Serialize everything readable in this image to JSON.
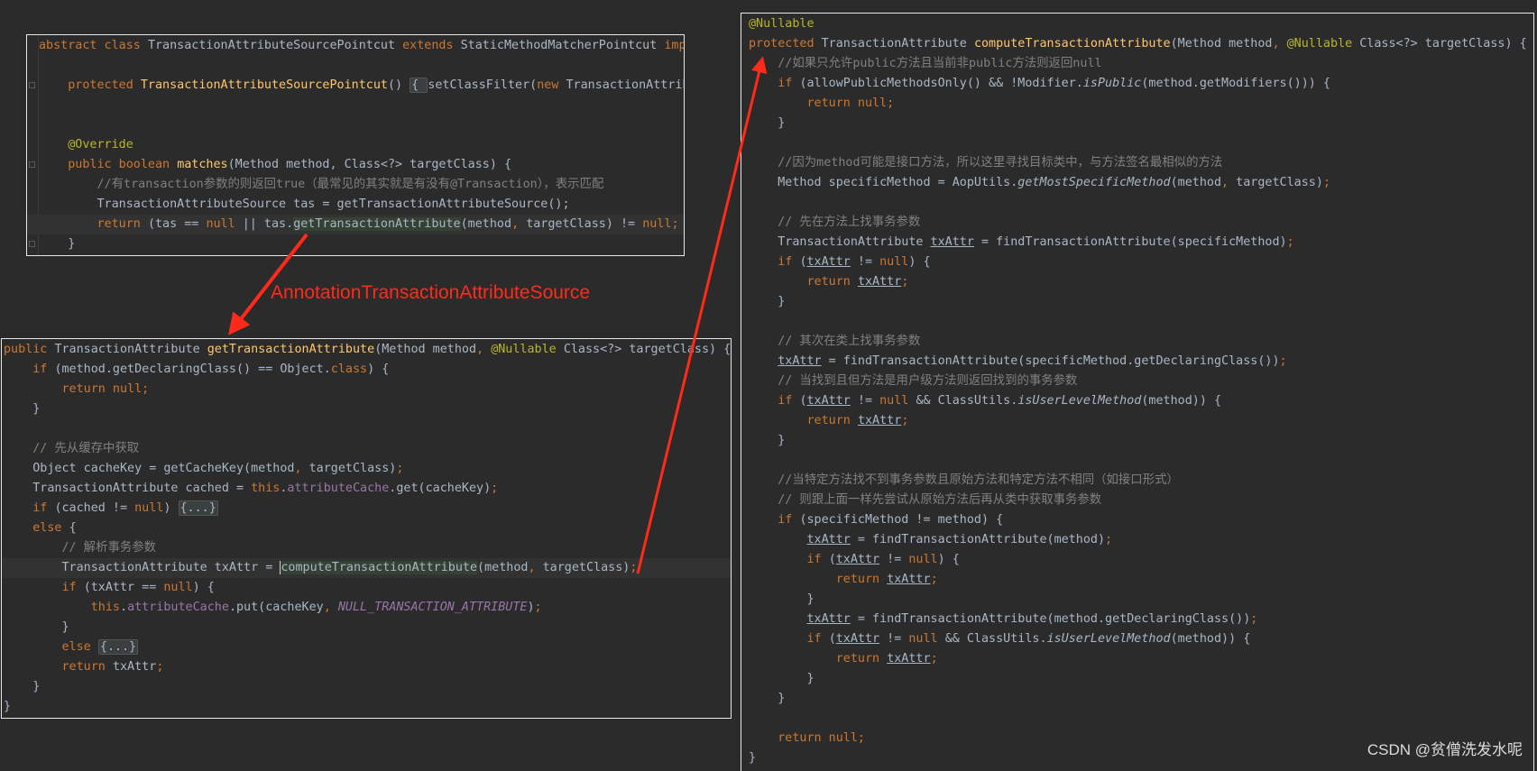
{
  "colors": {
    "background": "#2b2b2b",
    "keyword": "#cc7832",
    "method_declaration": "#ffc66d",
    "annotation": "#bbb529",
    "comment": "#808080",
    "field": "#9876aa",
    "plain": "#a9b7c6",
    "arrow": "#ff2a1a"
  },
  "caption": "AnnotationTransactionAttributeSource",
  "watermark": "CSDN @贫僧洗发水呢",
  "panels": [
    {
      "id": "pointcut",
      "lines": [
        [
          [
            "kw",
            "abstract class "
          ],
          [
            "",
            "TransactionAttributeSourcePointcut "
          ],
          [
            "kw",
            "extends "
          ],
          [
            "",
            "StaticMethodMatcherPointcut "
          ],
          [
            "kw",
            "imp"
          ]
        ],
        [],
        [
          [
            "",
            "    "
          ],
          [
            "kw",
            "protected "
          ],
          [
            "fn",
            "TransactionAttributeSourcePointcut"
          ],
          [
            "",
            "() "
          ],
          [
            "fb",
            "{ "
          ],
          [
            "",
            "setClassFilter("
          ],
          [
            "kw",
            "new "
          ],
          [
            "",
            "TransactionAttrib"
          ]
        ],
        [],
        [],
        [
          [
            "",
            "    "
          ],
          [
            "an",
            "@Override"
          ]
        ],
        [
          [
            "",
            "    "
          ],
          [
            "kw",
            "public boolean "
          ],
          [
            "fn",
            "matches"
          ],
          [
            "",
            "(Method method, Class<?> targetClass) {"
          ]
        ],
        [
          [
            "",
            "        "
          ],
          [
            "cm",
            "//有transaction参数的则返回true（最常见的其实就是有没有@Transaction），表示匹配"
          ]
        ],
        [
          [
            "",
            "        TransactionAttributeSource tas = getTransactionAttributeSource();"
          ]
        ],
        [
          [
            "",
            "        "
          ],
          [
            "kw",
            "return "
          ],
          [
            "",
            "(tas == "
          ],
          [
            "kw",
            "null "
          ],
          [
            "",
            "|| tas."
          ],
          [
            "mh",
            "getTransactionAttribute"
          ],
          [
            "",
            "(method"
          ],
          [
            "kw",
            ", "
          ],
          [
            "",
            "targetClass) != "
          ],
          [
            "kw",
            "null"
          ],
          [
            "kw",
            ";"
          ]
        ],
        [
          [
            "",
            "    }"
          ]
        ]
      ]
    },
    {
      "id": "get-attribute",
      "lines": [
        [
          [
            "kw",
            "public "
          ],
          [
            "",
            "TransactionAttribute "
          ],
          [
            "fn",
            "getTransactionAttribute"
          ],
          [
            "",
            "(Method method"
          ],
          [
            "kw",
            ", "
          ],
          [
            "an",
            "@Nullable "
          ],
          [
            "",
            "Class<?> targetClass) {"
          ]
        ],
        [
          [
            "",
            "    "
          ],
          [
            "kw",
            "if "
          ],
          [
            "",
            "(method.getDeclaringClass() == Object."
          ],
          [
            "kw",
            "class"
          ],
          [
            "",
            ") {"
          ]
        ],
        [
          [
            "",
            "        "
          ],
          [
            "kw",
            "return null;"
          ]
        ],
        [
          [
            "",
            "    }"
          ]
        ],
        [],
        [
          [
            "",
            "    "
          ],
          [
            "cm",
            "// 先从缓存中获取"
          ]
        ],
        [
          [
            "",
            "    Object cacheKey = getCacheKey(method"
          ],
          [
            "kw",
            ", "
          ],
          [
            "",
            "targetClass)"
          ],
          [
            "kw",
            ";"
          ]
        ],
        [
          [
            "",
            "    TransactionAttribute cached = "
          ],
          [
            "kw",
            "this"
          ],
          [
            "",
            "."
          ],
          [
            "fld",
            "attributeCache"
          ],
          [
            "",
            ".get(cacheKey)"
          ],
          [
            "kw",
            ";"
          ]
        ],
        [
          [
            "",
            "    "
          ],
          [
            "kw",
            "if "
          ],
          [
            "",
            "(cached != "
          ],
          [
            "kw",
            "null"
          ],
          [
            "",
            ") "
          ],
          [
            "fb",
            "{...}"
          ]
        ],
        [
          [
            "",
            "    "
          ],
          [
            "kw",
            "else "
          ],
          [
            "",
            "{"
          ]
        ],
        [
          [
            "",
            "        "
          ],
          [
            "cm",
            "// 解析事务参数"
          ]
        ],
        [
          [
            "",
            "        TransactionAttribute txAttr = "
          ],
          [
            "caret",
            ""
          ],
          [
            "mh",
            "computeTransactionAttribute"
          ],
          [
            "",
            "(method"
          ],
          [
            "kw",
            ", "
          ],
          [
            "",
            "targetClass)"
          ],
          [
            "kw",
            ";"
          ]
        ],
        [
          [
            "",
            "        "
          ],
          [
            "kw",
            "if "
          ],
          [
            "",
            "(txAttr == "
          ],
          [
            "kw",
            "null"
          ],
          [
            "",
            ") {"
          ]
        ],
        [
          [
            "",
            "            "
          ],
          [
            "kw",
            "this"
          ],
          [
            "",
            "."
          ],
          [
            "fld",
            "attributeCache"
          ],
          [
            "",
            ".put(cacheKey"
          ],
          [
            "kw",
            ", "
          ],
          [
            "cst",
            "NULL_TRANSACTION_ATTRIBUTE"
          ],
          [
            "",
            ")"
          ],
          [
            "kw",
            ";"
          ]
        ],
        [
          [
            "",
            "        }"
          ]
        ],
        [
          [
            "",
            "        "
          ],
          [
            "kw",
            "else "
          ],
          [
            "fb",
            "{...}"
          ]
        ],
        [
          [
            "",
            "        "
          ],
          [
            "kw",
            "return "
          ],
          [
            "",
            "txAttr"
          ],
          [
            "kw",
            ";"
          ]
        ],
        [
          [
            "",
            "    }"
          ]
        ],
        [
          [
            "",
            "}"
          ]
        ]
      ]
    },
    {
      "id": "compute-attribute",
      "lines": [
        [
          [
            "an",
            "@Nullable"
          ]
        ],
        [
          [
            "kw",
            "protected "
          ],
          [
            "",
            "TransactionAttribute "
          ],
          [
            "fn",
            "computeTransactionAttribute"
          ],
          [
            "",
            "(Method method"
          ],
          [
            "kw",
            ", "
          ],
          [
            "an",
            "@Nullable "
          ],
          [
            "",
            "Class<?> targetClass) {"
          ]
        ],
        [
          [
            "",
            "    "
          ],
          [
            "cm",
            "//如果只允许public方法且当前非public方法则返回null"
          ]
        ],
        [
          [
            "",
            "    "
          ],
          [
            "kw",
            "if "
          ],
          [
            "",
            "(allowPublicMethodsOnly() && !Modifier."
          ],
          [
            "st",
            "isPublic"
          ],
          [
            "",
            "(method.getModifiers())) {"
          ]
        ],
        [
          [
            "",
            "        "
          ],
          [
            "kw",
            "return null;"
          ]
        ],
        [
          [
            "",
            "    }"
          ]
        ],
        [],
        [
          [
            "",
            "    "
          ],
          [
            "cm",
            "//因为method可能是接口方法，所以这里寻找目标类中，与方法签名最相似的方法"
          ]
        ],
        [
          [
            "",
            "    Method specificMethod = AopUtils."
          ],
          [
            "st",
            "getMostSpecificMethod"
          ],
          [
            "",
            "(method"
          ],
          [
            "kw",
            ", "
          ],
          [
            "",
            "targetClass)"
          ],
          [
            "kw",
            ";"
          ]
        ],
        [],
        [
          [
            "",
            "    "
          ],
          [
            "cm",
            "// 先在方法上找事务参数"
          ]
        ],
        [
          [
            "",
            "    TransactionAttribute "
          ],
          [
            "ul",
            "txAttr"
          ],
          [
            "",
            " = findTransactionAttribute(specificMethod)"
          ],
          [
            "kw",
            ";"
          ]
        ],
        [
          [
            "",
            "    "
          ],
          [
            "kw",
            "if "
          ],
          [
            "",
            "("
          ],
          [
            "ul",
            "txAttr"
          ],
          [
            "",
            " != "
          ],
          [
            "kw",
            "null"
          ],
          [
            "",
            ") {"
          ]
        ],
        [
          [
            "",
            "        "
          ],
          [
            "kw",
            "return "
          ],
          [
            "ul",
            "txAttr"
          ],
          [
            "kw",
            ";"
          ]
        ],
        [
          [
            "",
            "    }"
          ]
        ],
        [],
        [
          [
            "",
            "    "
          ],
          [
            "cm",
            "// 其次在类上找事务参数"
          ]
        ],
        [
          [
            "",
            "    "
          ],
          [
            "ul",
            "txAttr"
          ],
          [
            "",
            " = findTransactionAttribute(specificMethod.getDeclaringClass())"
          ],
          [
            "kw",
            ";"
          ]
        ],
        [
          [
            "",
            "    "
          ],
          [
            "cm",
            "// 当找到且但方法是用户级方法则返回找到的事务参数"
          ]
        ],
        [
          [
            "",
            "    "
          ],
          [
            "kw",
            "if "
          ],
          [
            "",
            "("
          ],
          [
            "ul",
            "txAttr"
          ],
          [
            "",
            " != "
          ],
          [
            "kw",
            "null "
          ],
          [
            "",
            "&& ClassUtils."
          ],
          [
            "st",
            "isUserLevelMethod"
          ],
          [
            "",
            "(method)) {"
          ]
        ],
        [
          [
            "",
            "        "
          ],
          [
            "kw",
            "return "
          ],
          [
            "ul",
            "txAttr"
          ],
          [
            "kw",
            ";"
          ]
        ],
        [
          [
            "",
            "    }"
          ]
        ],
        [],
        [
          [
            "",
            "    "
          ],
          [
            "cm",
            "//当特定方法找不到事务参数且原始方法和特定方法不相同（如接口形式）"
          ]
        ],
        [
          [
            "",
            "    "
          ],
          [
            "cm",
            "// 则跟上面一样先尝试从原始方法后再从类中获取事务参数"
          ]
        ],
        [
          [
            "",
            "    "
          ],
          [
            "kw",
            "if "
          ],
          [
            "",
            "(specificMethod != method) {"
          ]
        ],
        [
          [
            "",
            "        "
          ],
          [
            "ul",
            "txAttr"
          ],
          [
            "",
            " = findTransactionAttribute(method)"
          ],
          [
            "kw",
            ";"
          ]
        ],
        [
          [
            "",
            "        "
          ],
          [
            "kw",
            "if "
          ],
          [
            "",
            "("
          ],
          [
            "ul",
            "txAttr"
          ],
          [
            "",
            " != "
          ],
          [
            "kw",
            "null"
          ],
          [
            "",
            ") {"
          ]
        ],
        [
          [
            "",
            "            "
          ],
          [
            "kw",
            "return "
          ],
          [
            "ul",
            "txAttr"
          ],
          [
            "kw",
            ";"
          ]
        ],
        [
          [
            "",
            "        }"
          ]
        ],
        [
          [
            "",
            "        "
          ],
          [
            "ul",
            "txAttr"
          ],
          [
            "",
            " = findTransactionAttribute(method.getDeclaringClass())"
          ],
          [
            "kw",
            ";"
          ]
        ],
        [
          [
            "",
            "        "
          ],
          [
            "kw",
            "if "
          ],
          [
            "",
            "("
          ],
          [
            "ul",
            "txAttr"
          ],
          [
            "",
            " != "
          ],
          [
            "kw",
            "null "
          ],
          [
            "",
            "&& ClassUtils."
          ],
          [
            "st",
            "isUserLevelMethod"
          ],
          [
            "",
            "(method)) {"
          ]
        ],
        [
          [
            "",
            "            "
          ],
          [
            "kw",
            "return "
          ],
          [
            "ul",
            "txAttr"
          ],
          [
            "kw",
            ";"
          ]
        ],
        [
          [
            "",
            "        }"
          ]
        ],
        [
          [
            "",
            "    }"
          ]
        ],
        [],
        [
          [
            "",
            "    "
          ],
          [
            "kw",
            "return null;"
          ]
        ],
        [
          [
            "",
            "}"
          ]
        ]
      ]
    }
  ]
}
